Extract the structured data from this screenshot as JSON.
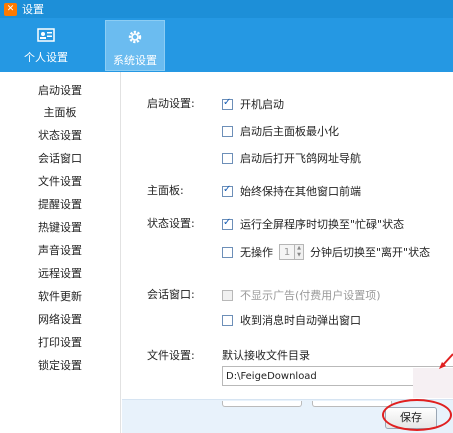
{
  "window": {
    "title": "设置"
  },
  "top_tabs": [
    {
      "label": "个人设置",
      "icon": "user-card-icon"
    },
    {
      "label": "系统设置",
      "icon": "gear-icon"
    }
  ],
  "sidebar": {
    "items": [
      {
        "label": "启动设置"
      },
      {
        "label": "主面板"
      },
      {
        "label": "状态设置"
      },
      {
        "label": "会话窗口"
      },
      {
        "label": "文件设置"
      },
      {
        "label": "提醒设置"
      },
      {
        "label": "热键设置"
      },
      {
        "label": "声音设置"
      },
      {
        "label": "远程设置"
      },
      {
        "label": "软件更新"
      },
      {
        "label": "网络设置"
      },
      {
        "label": "打印设置"
      },
      {
        "label": "锁定设置"
      }
    ]
  },
  "startup": {
    "label": "启动设置:",
    "options": [
      {
        "label": "开机启动",
        "checked": true
      },
      {
        "label": "启动后主面板最小化",
        "checked": false
      },
      {
        "label": "启动后打开飞鸽网址导航",
        "checked": false
      }
    ]
  },
  "main_panel": {
    "label": "主面板:",
    "option": {
      "label": "始终保持在其他窗口前端",
      "checked": true
    }
  },
  "status": {
    "label": "状态设置:",
    "fullscreen_option": {
      "label": "运行全屏程序时切换至\"忙碌\"状态",
      "checked": true
    },
    "idle_option": {
      "prefix": "无操作",
      "minutes": "1",
      "suffix": "分钟后切换至\"离开\"状态",
      "checked": false
    }
  },
  "chat_window": {
    "label": "会话窗口:",
    "options": [
      {
        "label": "不显示广告(付费用户设置项)",
        "checked": false,
        "disabled": true
      },
      {
        "label": "收到消息时自动弹出窗口",
        "checked": false
      }
    ]
  },
  "file": {
    "label": "文件设置:",
    "dir_label": "默认接收文件目录",
    "dir_value": "D:\\FeigeDownload"
  },
  "footer": {
    "save_label": "保存"
  },
  "colors": {
    "titlebar": "#1d8fd8",
    "topbar": "#2598e3",
    "annotation": "#e02020"
  }
}
